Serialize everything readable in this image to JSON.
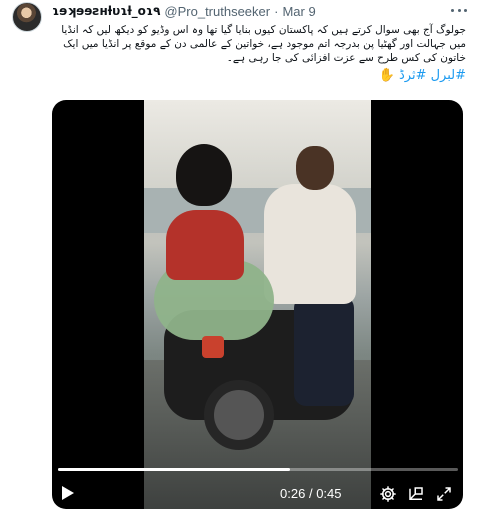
{
  "tweet": {
    "display_name": "ɿɘʞɘɘƨʜƚυɿƚ_oɿ٩",
    "handle": "@Pro_truthseeker",
    "separator": "·",
    "date": "Mar 9",
    "text": "جولوگ آج بھی سوال کرتے ہیں کہ پاکستان کیوں بنایا گیا تھا وہ اس وڈیو کو دیکھ لیں کہ انڈیا میں جہالت اور گھٹیا پن بدرجہ اتم موجود ہے، خواتین کے عالمی دن کے موقع پر انڈیا میں ایک خاتون کی کس طرح سے عزت افزائی کی جا رہی ہے۔",
    "hashtags": "#لبرل #ثرڈ",
    "hand_icon": "raised-hand-icon"
  },
  "video": {
    "progress": 0.58,
    "current_time": "0:26",
    "time_separator": "/",
    "duration": "0:45"
  },
  "icons": {
    "more": "more-horizontal-icon",
    "play": "play-icon",
    "settings": "gear-icon",
    "picture_in_picture": "dock-icon",
    "fullscreen": "fullscreen-icon"
  }
}
